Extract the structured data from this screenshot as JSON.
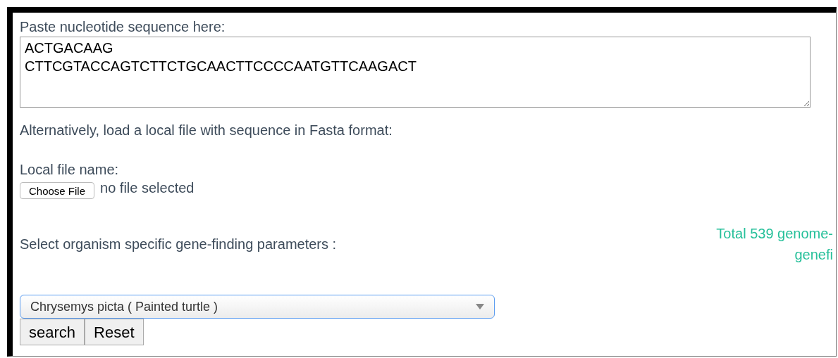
{
  "sequence_label": "Paste nucleotide sequence here:",
  "sequence_field": {
    "value": "ACTGACAAG\nCTTCGTACCAGTCTTCTGCAACTTCCCCAATGTTCAAGACT"
  },
  "alternative_note": "Alternatively, load a local file with sequence in Fasta format:",
  "file_label": "Local file name:",
  "file_button": "Choose File",
  "file_status": "no file selected",
  "organism_label": "Select organism specific gene-finding parameters :",
  "info_lines": [
    "Total 539 genome-",
    "genefi"
  ],
  "organism_select": {
    "value": "Chrysemys picta ( Painted turtle )"
  },
  "buttons": [
    "search",
    "Reset"
  ]
}
